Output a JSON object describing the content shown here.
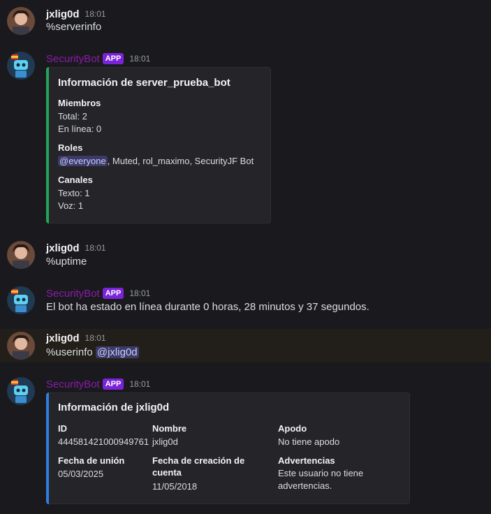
{
  "messages": [
    {
      "author": "jxlig0d",
      "time": "18:01",
      "text": "%serverinfo"
    },
    {
      "author": "SecurityBot",
      "tag": "APP",
      "time": "18:01",
      "embed": {
        "accent": "#23a559",
        "title": "Información de server_prueba_bot",
        "fields": [
          {
            "name": "Miembros",
            "lines": [
              "Total: 2",
              "En línea: 0"
            ]
          },
          {
            "name": "Roles",
            "mention": "@everyone",
            "rest": ", Muted, rol_maximo, SecurityJF Bot"
          },
          {
            "name": "Canales",
            "lines": [
              "Texto: 1",
              "Voz: 1"
            ]
          }
        ]
      }
    },
    {
      "author": "jxlig0d",
      "time": "18:01",
      "text": "%uptime"
    },
    {
      "author": "SecurityBot",
      "tag": "APP",
      "time": "18:01",
      "text": "El bot ha estado en línea durante 0 horas, 28 minutos y 37 segundos."
    },
    {
      "author": "jxlig0d",
      "time": "18:01",
      "text": "%userinfo ",
      "mention": "@jxlig0d"
    },
    {
      "author": "SecurityBot",
      "tag": "APP",
      "time": "18:01",
      "embed": {
        "accent": "#2f7fe0",
        "title": "Información de jxlig0d",
        "fields": [
          {
            "name": "ID",
            "value": "444581421000949761"
          },
          {
            "name": "Nombre",
            "value": "jxlig0d"
          },
          {
            "name": "Apodo",
            "value": "No tiene apodo"
          },
          {
            "name": "Fecha de unión",
            "value": "05/03/2025"
          },
          {
            "name": "Fecha de creación de cuenta",
            "value": "11/05/2018"
          },
          {
            "name": "Advertencias",
            "value": "Este usuario no tiene advertencias."
          }
        ]
      }
    }
  ],
  "colors": {
    "background": "#1a1a1e",
    "bot_name": "#8a1aa8",
    "app_tag": "#7b23d9",
    "mention_bg": "#3c3a66"
  },
  "icons": {
    "user_avatar": "user-avatar-icon",
    "bot_avatar": "bot-avatar-icon"
  }
}
